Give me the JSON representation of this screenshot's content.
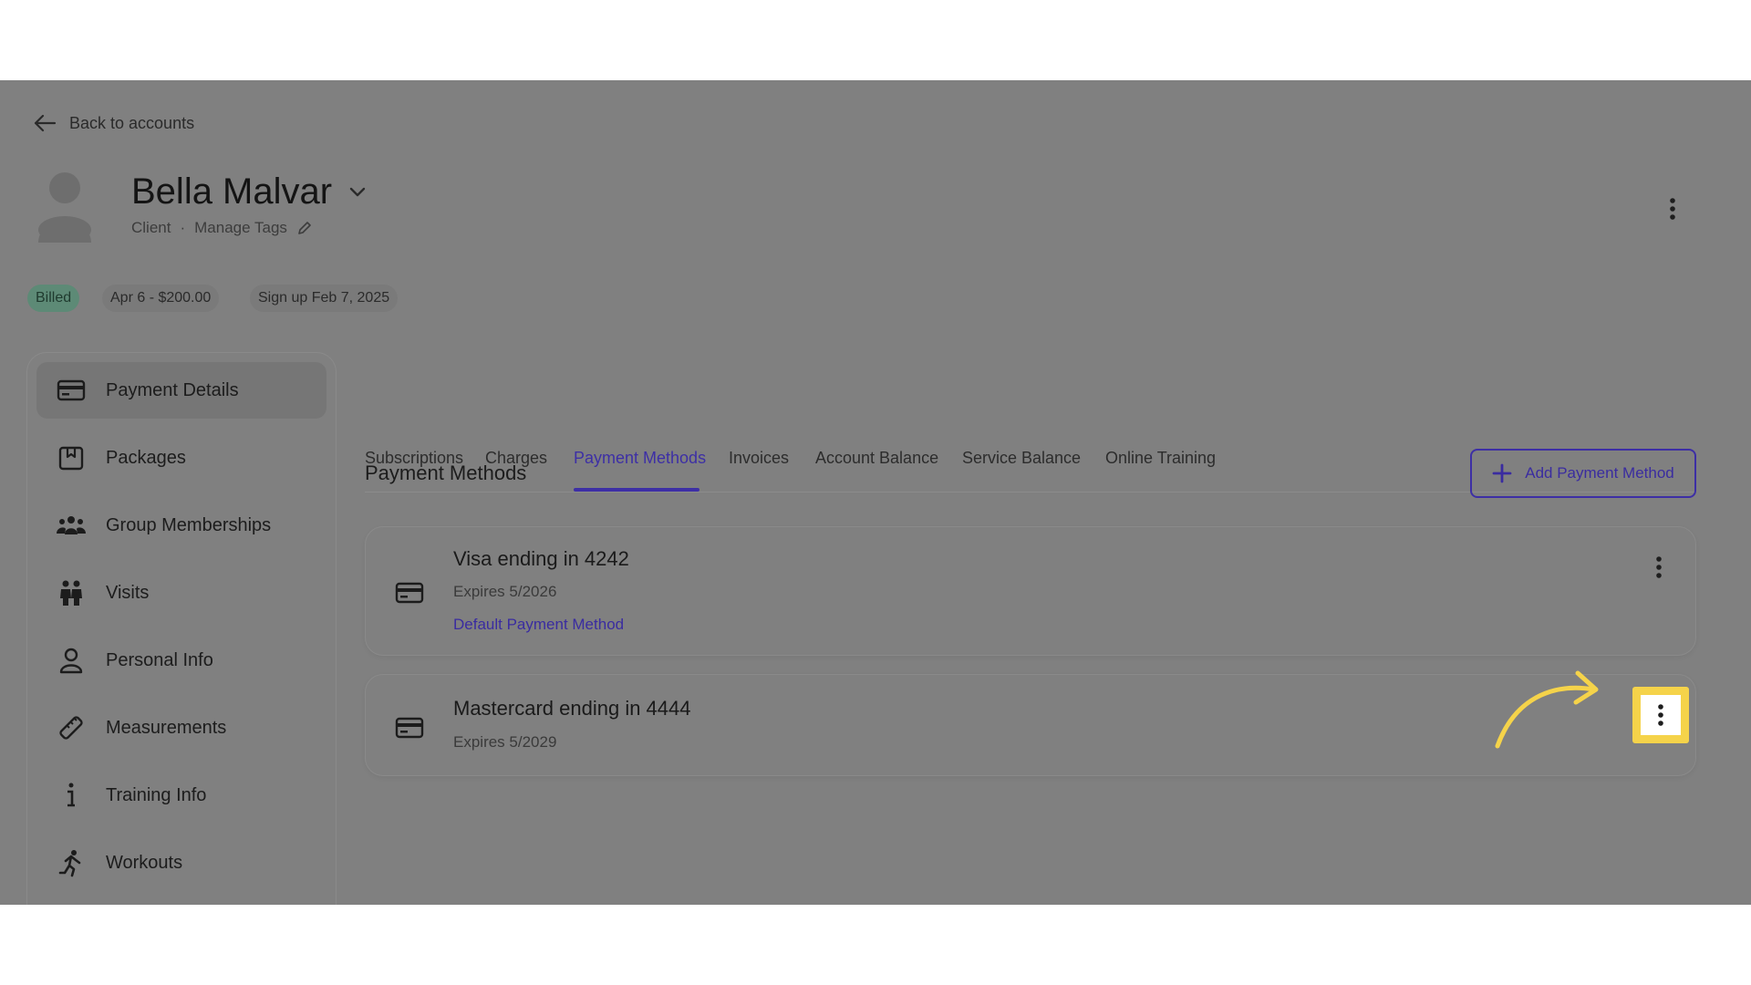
{
  "back": {
    "label": "Back to accounts"
  },
  "client": {
    "name": "Bella Malvar",
    "role": "Client",
    "separator": "·",
    "manage_tags": "Manage Tags"
  },
  "badges": {
    "billed": "Billed",
    "payment": "Apr 6 - $200.00",
    "signup": "Sign up Feb 7, 2025"
  },
  "sidebar": {
    "items": [
      {
        "label": "Payment Details",
        "icon": "credit-card-icon",
        "active": true
      },
      {
        "label": "Packages",
        "icon": "package-icon"
      },
      {
        "label": "Group Memberships",
        "icon": "group-icon"
      },
      {
        "label": "Visits",
        "icon": "visits-icon"
      },
      {
        "label": "Personal Info",
        "icon": "person-icon"
      },
      {
        "label": "Measurements",
        "icon": "ruler-icon"
      },
      {
        "label": "Training Info",
        "icon": "info-icon"
      },
      {
        "label": "Workouts",
        "icon": "running-icon"
      }
    ]
  },
  "tabs": [
    {
      "label": "Subscriptions"
    },
    {
      "label": "Charges"
    },
    {
      "label": "Payment Methods",
      "active": true
    },
    {
      "label": "Invoices"
    },
    {
      "label": "Account Balance"
    },
    {
      "label": "Service Balance"
    },
    {
      "label": "Online Training"
    }
  ],
  "payment_methods": {
    "title": "Payment Methods",
    "add_button": "Add Payment Method",
    "cards": [
      {
        "title": "Visa ending in 4242",
        "expires": "Expires 5/2026",
        "default_label": "Default Payment Method"
      },
      {
        "title": "Mastercard ending in 4444",
        "expires": "Expires 5/2029"
      }
    ]
  },
  "colors": {
    "overlay": "#808080",
    "accent": "#3d2fa5",
    "highlight": "#f5d34a",
    "billed_badge": "#5d8a76"
  }
}
